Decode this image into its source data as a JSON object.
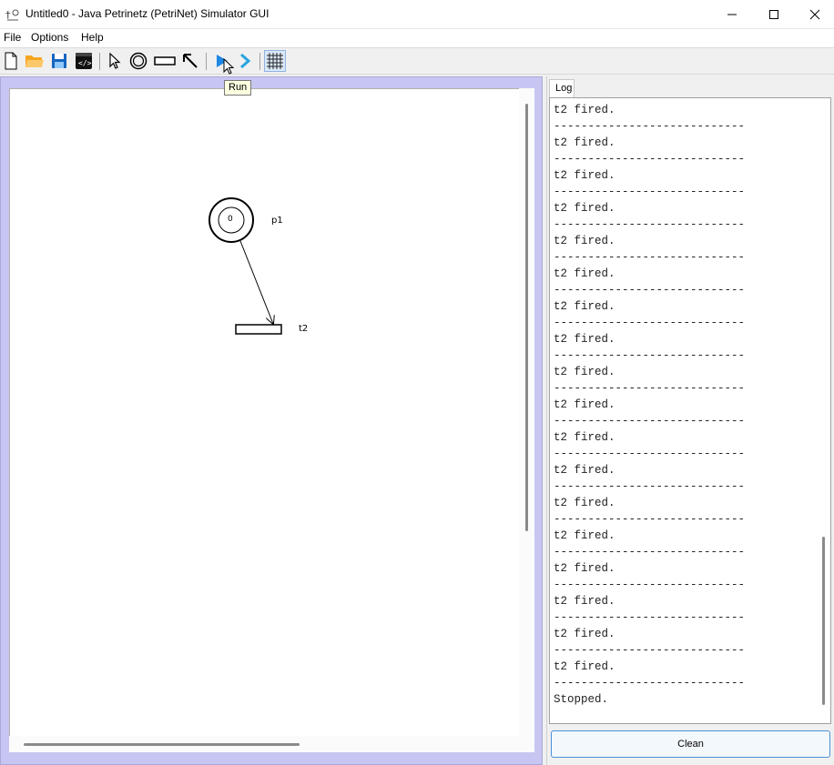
{
  "window": {
    "title": "Untitled0 - Java Petrinetz (PetriNet) Simulator GUI",
    "controls": [
      "minimize",
      "maximize",
      "close"
    ]
  },
  "menu": {
    "items": [
      "File",
      "Options",
      "Help"
    ]
  },
  "toolbar": {
    "buttons": [
      {
        "icon": "new-file-icon"
      },
      {
        "icon": "open-folder-icon"
      },
      {
        "icon": "save-icon"
      },
      {
        "icon": "code-icon"
      },
      {
        "icon": "select-pointer-icon"
      },
      {
        "icon": "place-circle-icon"
      },
      {
        "icon": "transition-rect-icon"
      },
      {
        "icon": "arc-arrow-icon"
      },
      {
        "icon": "run-play-icon"
      },
      {
        "icon": "step-chevron-icon"
      },
      {
        "icon": "grid-icon"
      }
    ],
    "tooltip": "Run"
  },
  "net": {
    "place": {
      "name": "p1",
      "tokens": "0"
    },
    "transition": {
      "name": "t2"
    }
  },
  "log": {
    "tab_label": "Log",
    "entry_fired": "t2 fired.",
    "separator": "----------------------------",
    "fired_count": 18,
    "final_line": "Stopped."
  },
  "buttons": {
    "clean_label": "Clean"
  },
  "colors": {
    "canvas_border": "#c7c6f2",
    "accent_blue": "#1e88e5",
    "open_folder": "#f5a623",
    "save_blue": "#1565c0"
  }
}
